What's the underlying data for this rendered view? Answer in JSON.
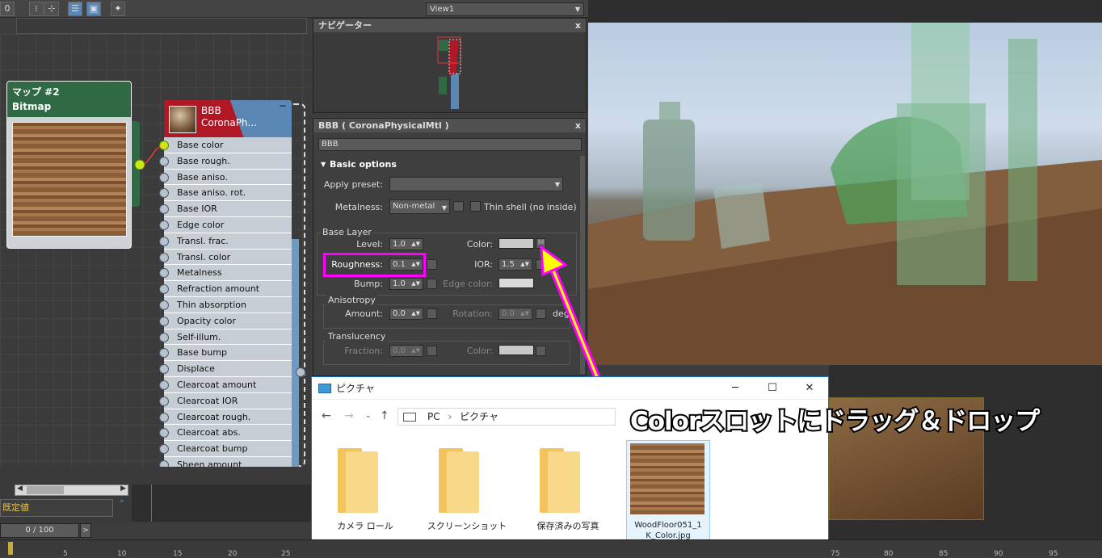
{
  "toolbar": {
    "view_selector": "View1"
  },
  "bitmap_node": {
    "title": "マップ #2",
    "type": "Bitmap"
  },
  "material_node": {
    "name_line1": "BBB",
    "name_line2": "CoronaPh...",
    "collapse_symbol": "−",
    "slots": [
      "Base color",
      "Base rough.",
      "Base aniso.",
      "Base aniso. rot.",
      "Base IOR",
      "Edge color",
      "Transl. frac.",
      "Transl. color",
      "Metalness",
      "Refraction amount",
      "Thin absorption",
      "Opacity color",
      "Self-illum.",
      "Base bump",
      "Displace",
      "Clearcoat amount",
      "Clearcoat IOR",
      "Clearcoat rough.",
      "Clearcoat abs.",
      "Clearcoat bump",
      "Sheen amount"
    ]
  },
  "navigator_panel": {
    "title": "ナビゲーター",
    "close": "x"
  },
  "material_panel": {
    "title": "BBB  ( CoronaPhysicalMtl )",
    "close": "x",
    "name_field": "BBB",
    "rollout": "Basic options",
    "apply_preset_label": "Apply preset:",
    "metalness_label": "Metalness:",
    "metalness_value": "Non-metal",
    "thin_shell_label": "Thin shell (no inside)",
    "base_layer": {
      "group": "Base Layer",
      "level_label": "Level:",
      "level_value": "1.0",
      "color_label": "Color:",
      "map_button": "M",
      "roughness_label": "Roughness:",
      "roughness_value": "0.1",
      "ior_label": "IOR:",
      "ior_value": "1.5",
      "bump_label": "Bump:",
      "bump_value": "1.0",
      "edge_color_label": "Edge color:"
    },
    "anisotropy": {
      "group": "Anisotropy",
      "amount_label": "Amount:",
      "amount_value": "0.0",
      "rotation_label": "Rotation:",
      "rotation_value": "0.0",
      "deg": "deg"
    },
    "translucency": {
      "group": "Translucency",
      "fraction_label": "Fraction:",
      "fraction_value": "0.0",
      "color_label": "Color:"
    }
  },
  "annotation": {
    "caption": "Colorスロットにドラッグ＆ドロップ",
    "arrow_color": "#ff00ff",
    "arrow_core": "#ffff00",
    "highlight_color": "#ff00ff"
  },
  "explorer": {
    "title": "ピクチャ",
    "address": [
      "PC",
      "ピクチャ"
    ],
    "items": [
      "カメラ ロール",
      "スクリーンショット",
      "保存済みの写真"
    ],
    "file_line1": "WoodFloor051_1",
    "file_line2": "K_Color.jpg"
  },
  "bottom": {
    "default_label": "既定値",
    "frame_counter": "0 / 100",
    "ruler_ticks": [
      "5",
      "10",
      "15",
      "20",
      "25",
      "75",
      "80",
      "85",
      "90",
      "95"
    ]
  }
}
